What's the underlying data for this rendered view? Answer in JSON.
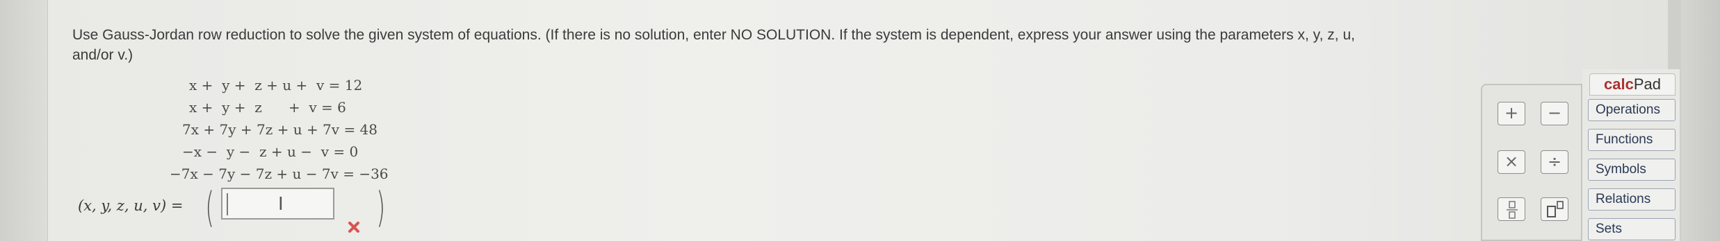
{
  "instructions": {
    "line1": "Use Gauss-Jordan row reduction to solve the given system of equations. (If there is no solution, enter NO SOLUTION. If the system is dependent, express your answer using the parameters x, y, z, u,",
    "line2": "and/or v.)"
  },
  "equations": [
    "x +  y +  z + u +  v = 12",
    "x +  y +  z      +  v = 6",
    "7x + 7y + 7z + u + 7v = 48",
    "−x −  y −  z + u −  v = 0",
    "−7x − 7y − 7z + u − 7v = −36"
  ],
  "answer": {
    "label": "(x, y, z, u, v) =",
    "value": "",
    "status_icon": "x-mark-icon",
    "status_color": "#d9534f"
  },
  "calcpad": {
    "title_prefix": "calc",
    "title_suffix": "Pad",
    "keys": {
      "plus": "+",
      "minus": "−",
      "times": "×",
      "divide": "÷",
      "fraction": "fraction",
      "superscript": "superscript"
    },
    "menu": [
      "Operations",
      "Functions",
      "Symbols",
      "Relations",
      "Sets"
    ]
  }
}
